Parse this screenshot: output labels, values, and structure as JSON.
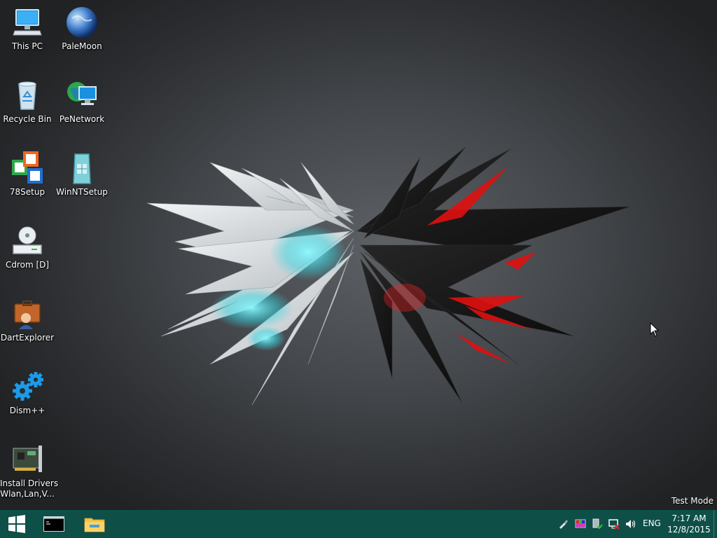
{
  "desktop": {
    "icons": [
      {
        "label": "This PC",
        "icon": "computer-icon"
      },
      {
        "label": "PaleMoon",
        "icon": "palemoon-globe-icon"
      },
      {
        "label": "Recycle Bin",
        "icon": "recycle-bin-icon"
      },
      {
        "label": "PeNetwork",
        "icon": "network-icon"
      },
      {
        "label": "78Setup",
        "icon": "setup-windows-icon"
      },
      {
        "label": "WinNTSetup",
        "icon": "winntsetup-icon"
      },
      {
        "label": "Cdrom [D]",
        "icon": "cdrom-drive-icon"
      },
      {
        "label": "DartExplorer",
        "icon": "dart-explorer-icon"
      },
      {
        "label": "Dism++",
        "icon": "gears-icon"
      },
      {
        "label_line1": "Install Drivers",
        "label_line2": "Wlan,Lan,V...",
        "icon": "network-card-icon"
      }
    ],
    "watermark": "Test Mode"
  },
  "taskbar": {
    "start": "windows-logo-icon",
    "pinned": [
      "command-prompt-icon",
      "file-explorer-icon"
    ],
    "tray": {
      "icons": [
        "usb-eject-icon",
        "color-display-icon",
        "security-icon",
        "network-disconnected-icon",
        "volume-icon"
      ],
      "language": "ENG",
      "time": "7:17 AM",
      "date": "12/8/2015"
    }
  },
  "colors": {
    "taskbar": "#0e4f48",
    "accent_red": "#e01010",
    "accent_cyan": "#4ff0ff"
  }
}
